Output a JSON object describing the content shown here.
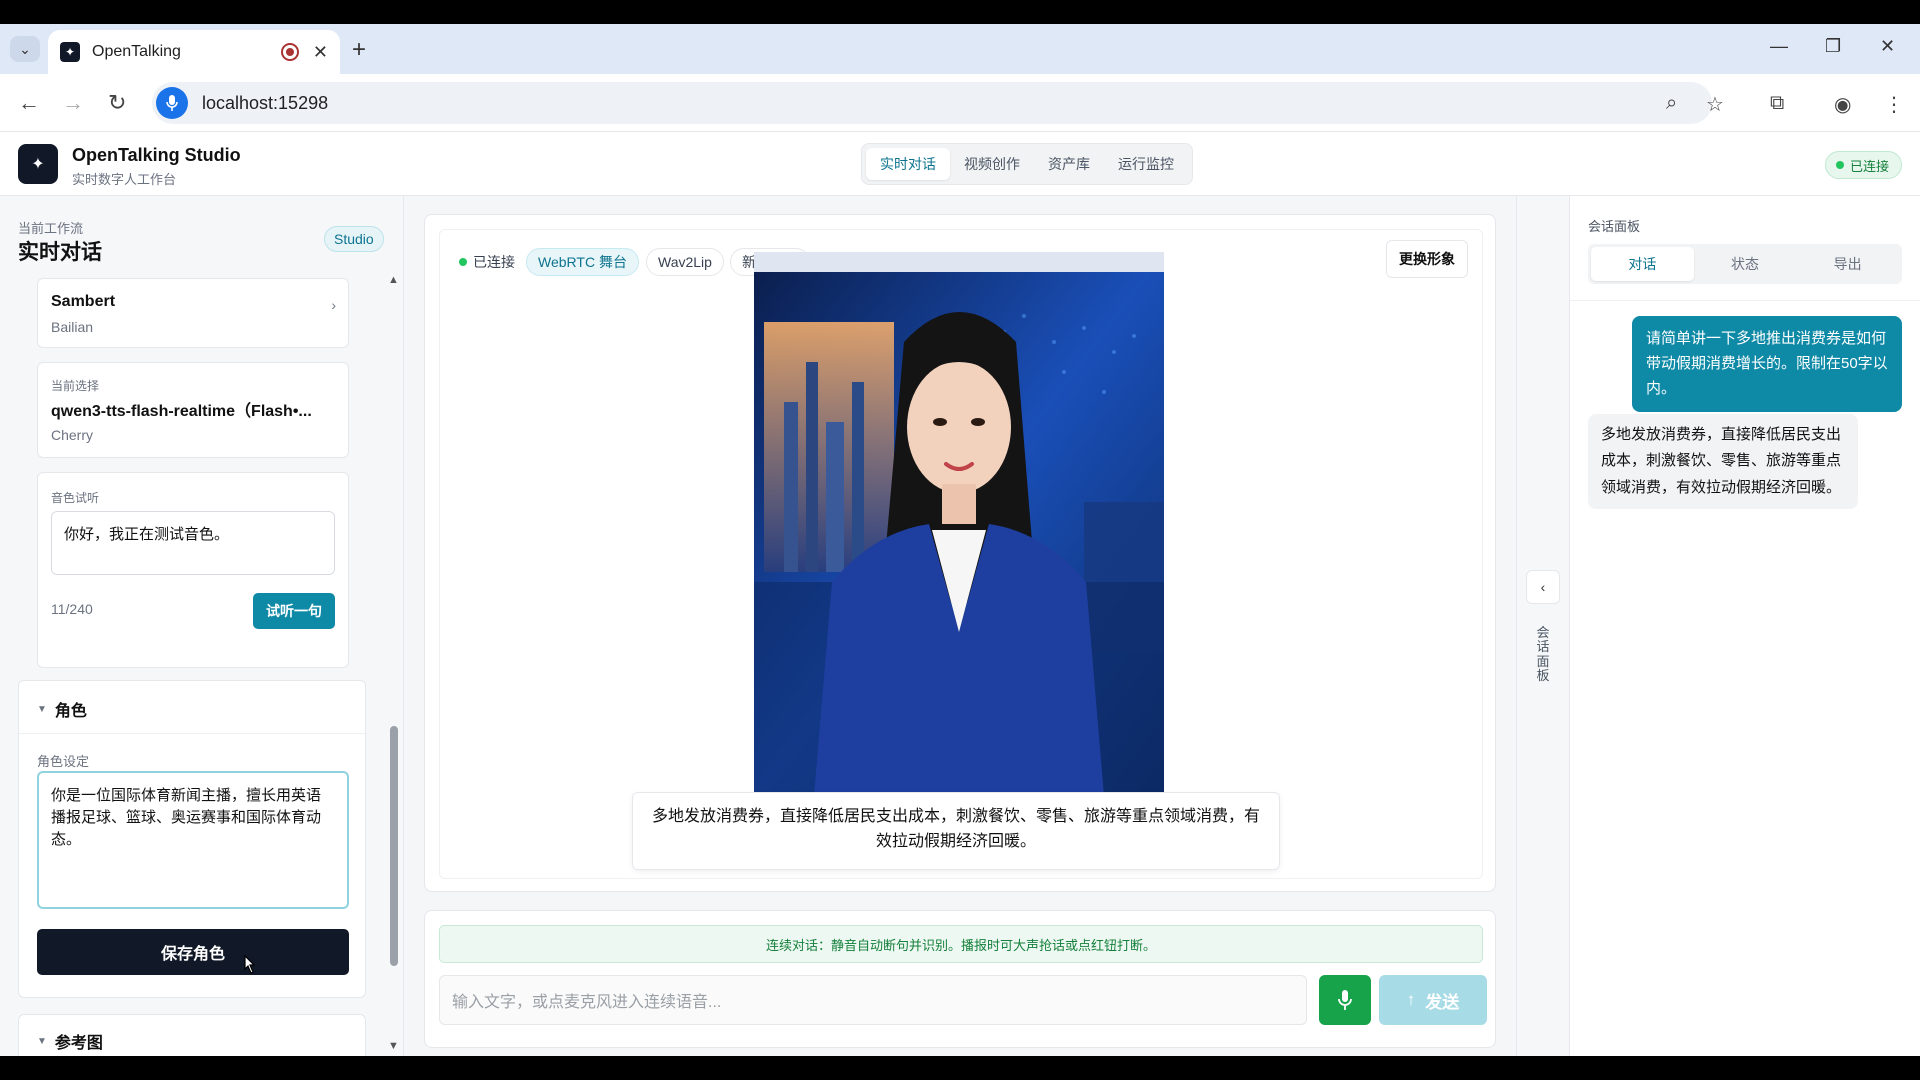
{
  "browser": {
    "tab_title": "OpenTalking",
    "url": "localhost:15298"
  },
  "header": {
    "brand": "OpenTalking Studio",
    "brand_sub": "实时数字人工作台",
    "nav": [
      "实时对话",
      "视频创作",
      "资产库",
      "运行监控"
    ],
    "active_nav": "实时对话",
    "status": "已连接"
  },
  "sidebar": {
    "workflow_label": "当前工作流",
    "workflow_title": "实时对话",
    "badge": "Studio",
    "voice_provider": {
      "name": "Sambert",
      "sub": "Bailian"
    },
    "current_selection": {
      "label": "当前选择",
      "model": "qwen3-tts-flash-realtime（Flash•...",
      "voice": "Cherry"
    },
    "voice_preview": {
      "label": "音色试听",
      "text": "你好，我正在测试音色。",
      "count": "11/240",
      "button": "试听一句"
    },
    "role_section": {
      "title": "角色",
      "field_label": "角色设定",
      "text": "你是一位国际体育新闻主播，擅长用英语播报足球、篮球、奥运赛事和国际体育动态。",
      "save_button": "保存角色"
    },
    "reference_section": {
      "title": "参考图"
    }
  },
  "stage": {
    "chips": {
      "connected": "已连接",
      "transport": "WebRTC 舞台",
      "model": "Wav2Lip",
      "persona": "新闻主播"
    },
    "change_avatar": "更换形象",
    "subtitle": "多地发放消费券，直接降低居民支出成本，刺激餐饮、零售、旅游等重点领域消费，有效拉动假期经济回暖。"
  },
  "input": {
    "hint": "连续对话：静音自动断句并识别。播报时可大声抢话或点红钮打断。",
    "placeholder": "输入文字，或点麦克风进入连续语音...",
    "send": "发送"
  },
  "strip": {
    "label": "会话面板"
  },
  "panel": {
    "title": "会话面板",
    "tabs": [
      "对话",
      "状态",
      "导出"
    ],
    "active_tab": "对话",
    "messages": {
      "user": "请简单讲一下多地推出消费券是如何带动假期消费增长的。限制在50字以内。",
      "bot": "多地发放消费券，直接降低居民支出成本，刺激餐饮、零售、旅游等重点领域消费，有效拉动假期经济回暖。"
    }
  },
  "colors": {
    "accent": "#0e89a6",
    "success": "#16a34a",
    "dark": "#111827"
  }
}
